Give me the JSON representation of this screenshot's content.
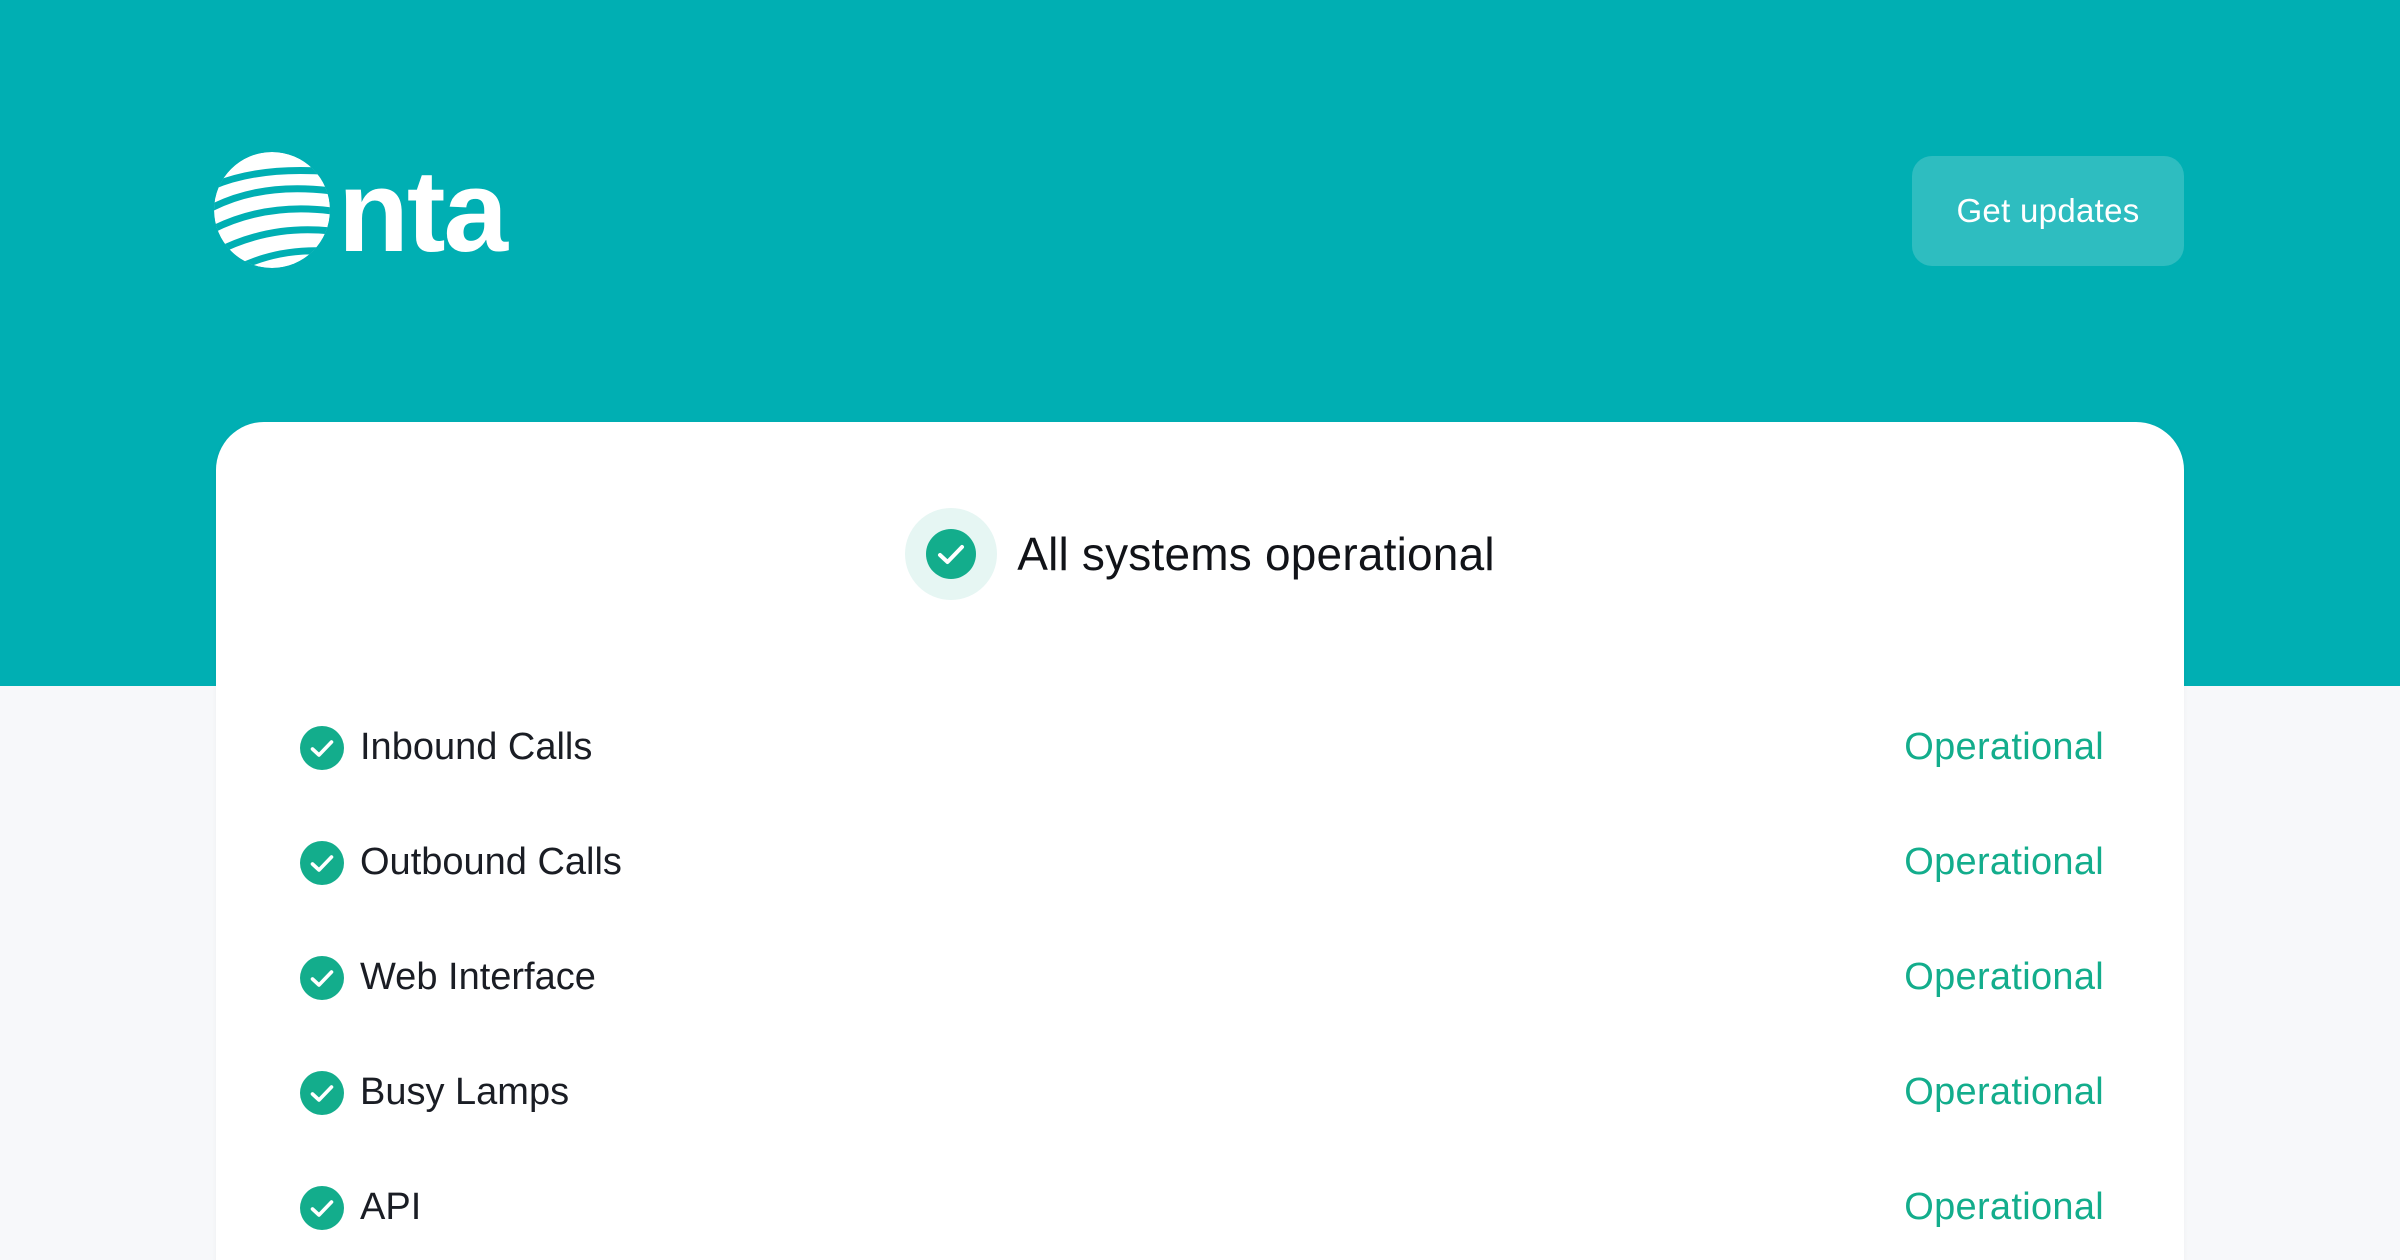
{
  "brand": {
    "logo_text": "nta",
    "logo_icon": "striped-globe-icon",
    "hero_color": "#00afb3",
    "accent_color": "#13ad8c"
  },
  "header": {
    "get_updates_label": "Get updates"
  },
  "overall": {
    "icon": "check-circle-icon",
    "text": "All systems operational"
  },
  "services": [
    {
      "name": "Inbound Calls",
      "status": "Operational",
      "icon": "check-circle-icon"
    },
    {
      "name": "Outbound Calls",
      "status": "Operational",
      "icon": "check-circle-icon"
    },
    {
      "name": "Web Interface",
      "status": "Operational",
      "icon": "check-circle-icon"
    },
    {
      "name": "Busy Lamps",
      "status": "Operational",
      "icon": "check-circle-icon"
    },
    {
      "name": "API",
      "status": "Operational",
      "icon": "check-circle-icon"
    }
  ]
}
